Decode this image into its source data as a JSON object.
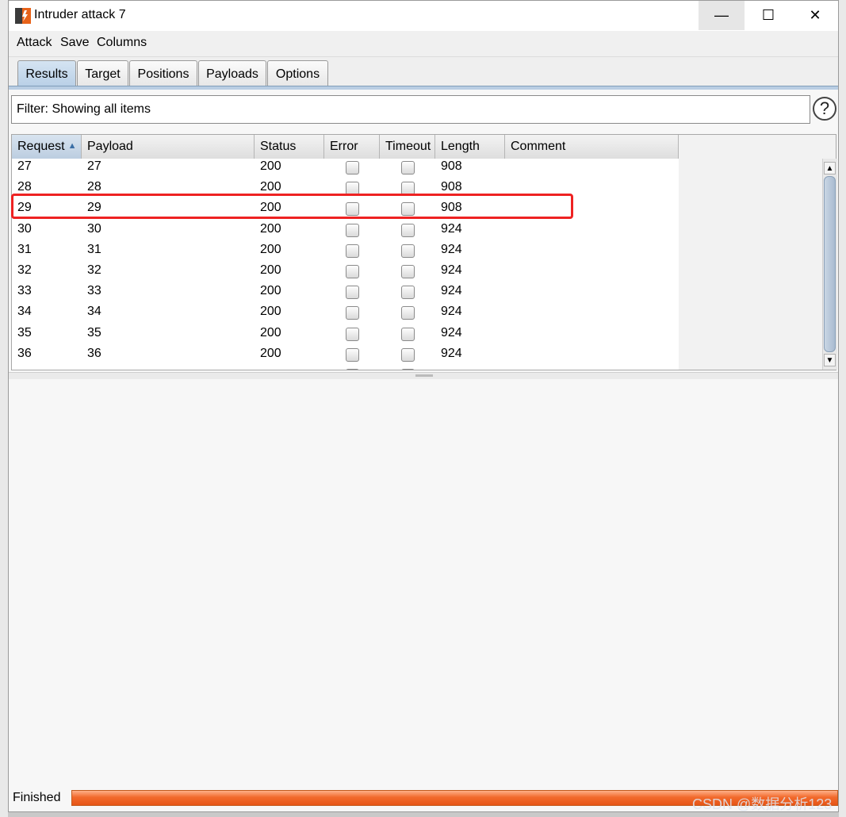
{
  "window": {
    "title": "Intruder attack 7"
  },
  "menu": [
    "Attack",
    "Save",
    "Columns"
  ],
  "tabs": [
    "Results",
    "Target",
    "Positions",
    "Payloads",
    "Options"
  ],
  "active_tab": "Results",
  "filter": {
    "text": "Filter: Showing all items"
  },
  "help_icon": "?",
  "table": {
    "columns": [
      "Request",
      "Payload",
      "Status",
      "Error",
      "Timeout",
      "Length",
      "Comment"
    ],
    "sorted_by": "Request",
    "rows": [
      {
        "request": "27",
        "payload": "27",
        "status": "200",
        "error": false,
        "timeout": false,
        "length": "908",
        "comment": ""
      },
      {
        "request": "28",
        "payload": "28",
        "status": "200",
        "error": false,
        "timeout": false,
        "length": "908",
        "comment": ""
      },
      {
        "request": "29",
        "payload": "29",
        "status": "200",
        "error": false,
        "timeout": false,
        "length": "908",
        "comment": "",
        "highlighted": true
      },
      {
        "request": "30",
        "payload": "30",
        "status": "200",
        "error": false,
        "timeout": false,
        "length": "924",
        "comment": ""
      },
      {
        "request": "31",
        "payload": "31",
        "status": "200",
        "error": false,
        "timeout": false,
        "length": "924",
        "comment": ""
      },
      {
        "request": "32",
        "payload": "32",
        "status": "200",
        "error": false,
        "timeout": false,
        "length": "924",
        "comment": ""
      },
      {
        "request": "33",
        "payload": "33",
        "status": "200",
        "error": false,
        "timeout": false,
        "length": "924",
        "comment": ""
      },
      {
        "request": "34",
        "payload": "34",
        "status": "200",
        "error": false,
        "timeout": false,
        "length": "924",
        "comment": ""
      },
      {
        "request": "35",
        "payload": "35",
        "status": "200",
        "error": false,
        "timeout": false,
        "length": "924",
        "comment": ""
      },
      {
        "request": "36",
        "payload": "36",
        "status": "200",
        "error": false,
        "timeout": false,
        "length": "924",
        "comment": ""
      }
    ]
  },
  "status": {
    "label": "Finished",
    "progress": 1.0
  },
  "watermark": "CSDN @数据分析123",
  "colors": {
    "highlight": "#ee2222",
    "progress": "#f26a2c",
    "active_tab": "#c4d8ec"
  }
}
